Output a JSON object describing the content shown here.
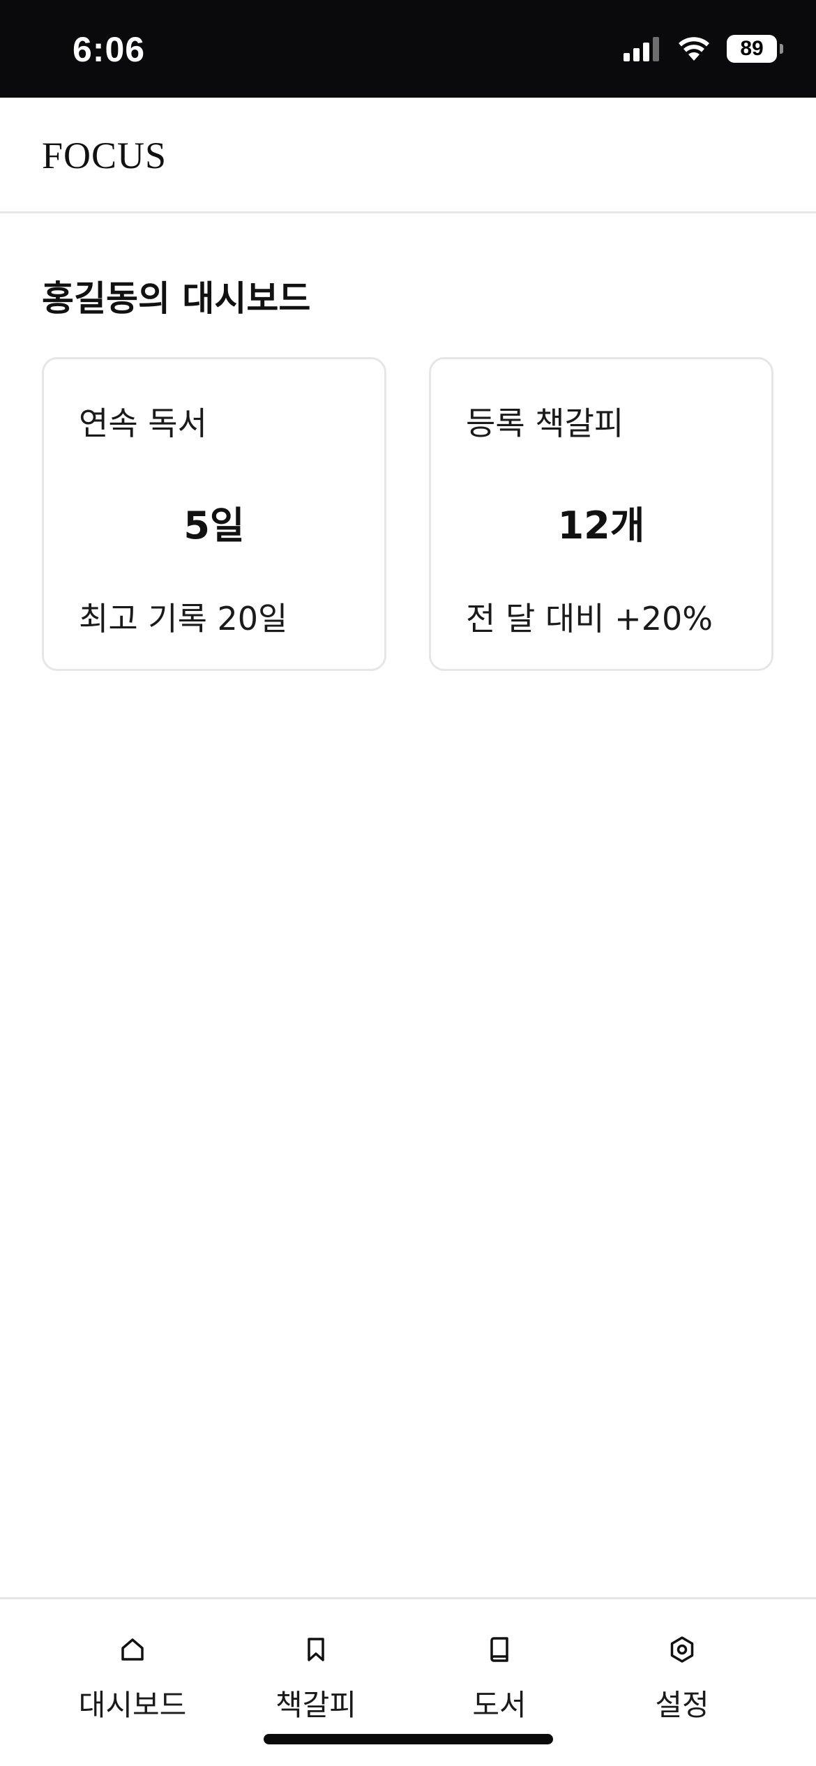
{
  "status_bar": {
    "time": "6:06",
    "battery": "89",
    "icons": [
      "cellular-signal-icon",
      "wifi-icon",
      "battery-icon"
    ]
  },
  "header": {
    "logo": "FOCUS"
  },
  "dashboard": {
    "title": "홍길동의 대시보드",
    "cards": [
      {
        "label": "연속 독서",
        "value": "5일",
        "sub": "최고 기록 20일"
      },
      {
        "label": "등록 책갈피",
        "value": "12개",
        "sub": "전 달 대비 +20%"
      }
    ]
  },
  "tab_bar": {
    "tabs": [
      {
        "label": "대시보드",
        "icon": "home-icon"
      },
      {
        "label": "책갈피",
        "icon": "bookmark-icon"
      },
      {
        "label": "도서",
        "icon": "book-icon"
      },
      {
        "label": "설정",
        "icon": "settings-icon"
      }
    ]
  },
  "colors": {
    "status_bar_bg": "#0a0a0c",
    "border": "#e6e6e6",
    "text": "#111111"
  }
}
